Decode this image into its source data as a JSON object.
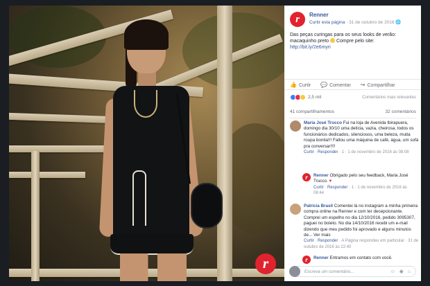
{
  "post": {
    "page_name": "Renner",
    "like_page": "Curtir esta página",
    "date": "31 de outubro de 2016",
    "globe": "🌐",
    "text": "Das peças curingas para os seus looks de verão: macaquinho preto",
    "emoji": "smiling-face",
    "compre": "Compre pelo site:",
    "link": "http://bit.ly/2e6myri"
  },
  "actions": {
    "like": "Curtir",
    "comment": "Comentar",
    "share": "Compartilhar"
  },
  "reactions": {
    "count": "2,5 mil",
    "sort": "Comentários mais relevantes"
  },
  "sharebar": {
    "shares": "41 compartilhamentos",
    "comments": "32 comentários"
  },
  "comments": [
    {
      "name": "Maria José Trucco",
      "text": "Fui na loja de Avenida Ibirapuera, domingo dia 30/10 uma delícia, vazia, cheirosa, todos os funcionários dedicados, silenciosos, uma beleza, muita roupa bonita!!! Faltou uma máquina de café, água, um sofá pra conversar!!!!",
      "like": "Curtir",
      "reply": "Responder",
      "likes": "1",
      "date": "1 de novembro de 2016 às 08:08"
    },
    {
      "name": "Patricia Brasil",
      "text": "Comentei lá no instagram a minha primeira compra online na Renner e com ter decepcionante. Comprei um espelho no dia 12/10/2016, pedido 3095307, paguei no boleto. No dia 14/10/2016 recebi um e-mail dizendo que meu pedido foi aprovado e alguns minutos de... Ver mais",
      "like": "Curtir",
      "reply": "Responder",
      "extra": "A Página respondeu em particular",
      "date": "31 de outubro de 2016 às 22:40"
    }
  ],
  "replies": [
    {
      "name": "Renner",
      "text": "Obrigado pelo seu feedback, Maria José Trucco.",
      "like": "Curtir",
      "reply": "Responder",
      "likes": "1",
      "date": "1 de novembro de 2016 às 08:44"
    },
    {
      "name": "Renner",
      "text": "Entramos em contato com você."
    }
  ],
  "input": {
    "placeholder": "Escreva um comentário..."
  },
  "colors": {
    "brand": "#e0232e",
    "link": "#365899"
  }
}
